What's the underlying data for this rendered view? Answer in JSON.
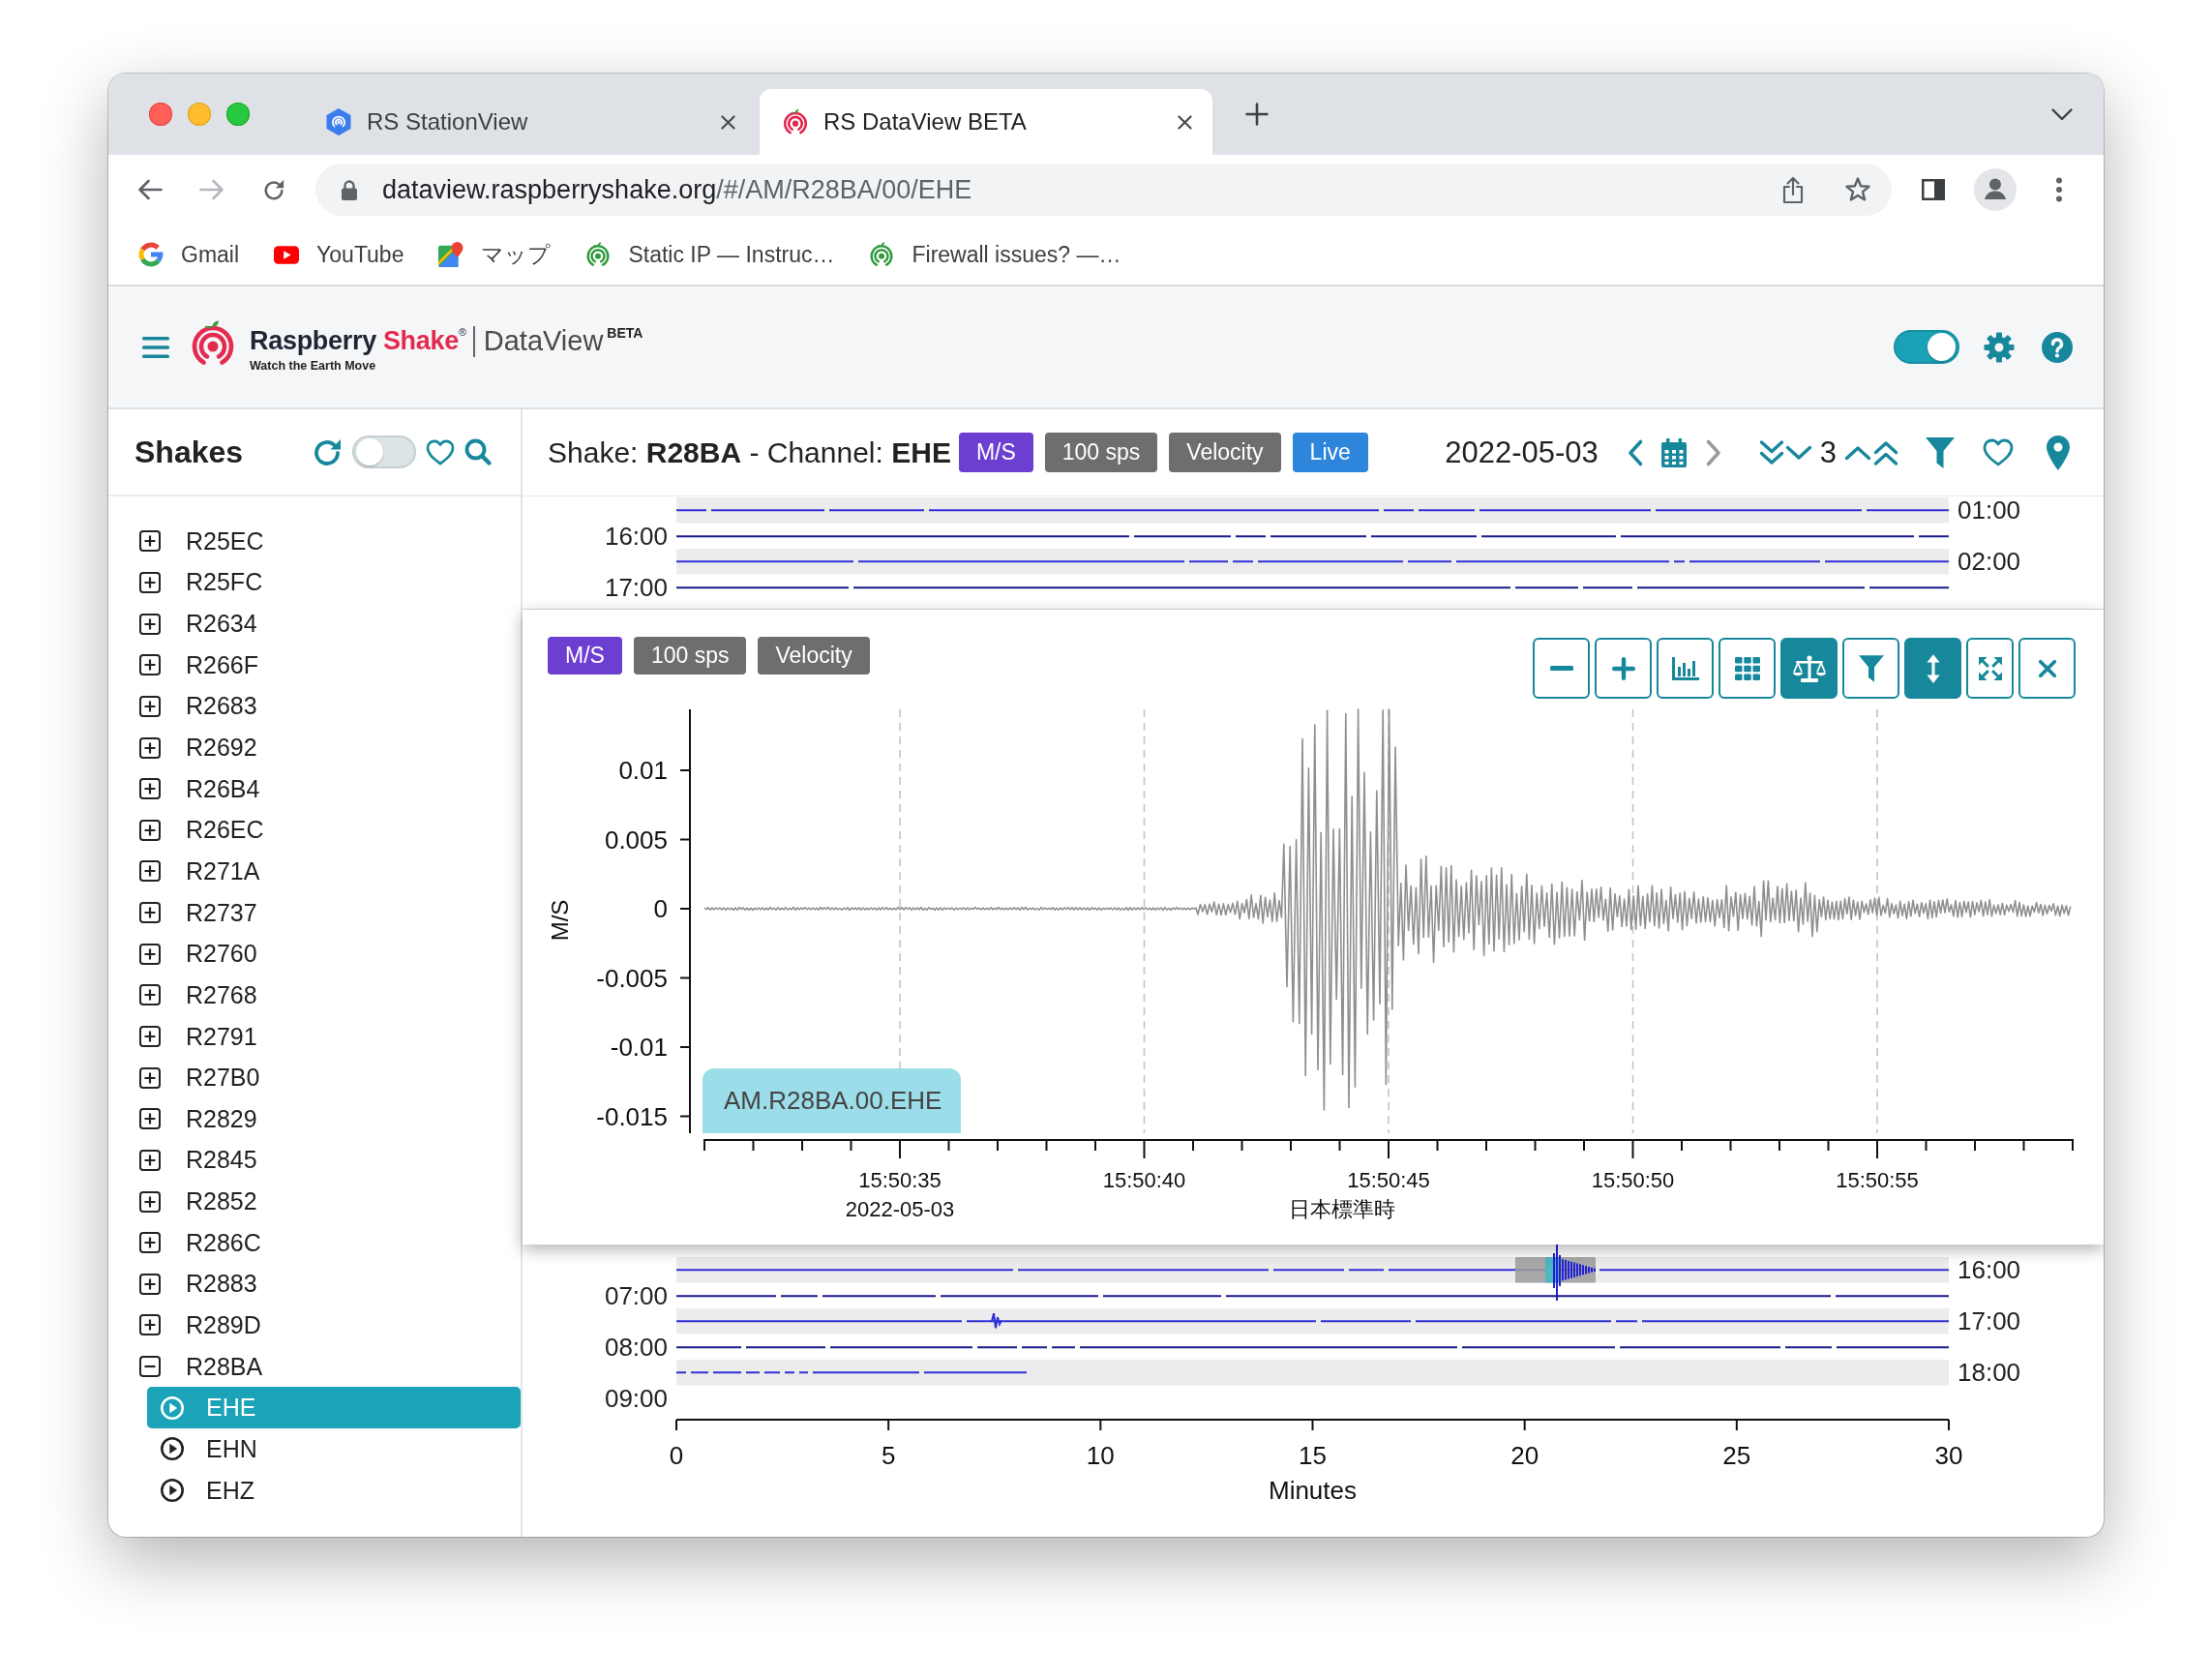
{
  "browser": {
    "tabs": [
      {
        "title": "RS StationView",
        "kind": "station",
        "selected": false
      },
      {
        "title": "RS DataView BETA",
        "kind": "dataview",
        "selected": true
      }
    ],
    "nav": {
      "back_disabled": false,
      "forward_disabled": true
    },
    "address": {
      "host": "dataview.raspberryshake.org",
      "path": "/#/AM/R28BA/00/EHE"
    },
    "bookmarks": [
      {
        "label": "Gmail",
        "kind": "google"
      },
      {
        "label": "YouTube",
        "kind": "video"
      },
      {
        "label": "マップ",
        "kind": "maps"
      },
      {
        "label": "Static IP — Instruc…",
        "kind": "shake"
      },
      {
        "label": "Firewall issues? —…",
        "kind": "shake"
      }
    ]
  },
  "app_header": {
    "brand": "Raspberry",
    "brand_accent": "Shake$^{®}$",
    "product": "DataView$^{BETA}$",
    "tagline": "Watch the Earth Move",
    "toggle": {
      "on": true
    }
  },
  "sidebar": {
    "title": "Shakes",
    "toggle": {
      "on": false
    },
    "stations": [
      {
        "label": "R25EC",
        "expanded": false
      },
      {
        "label": "R25FC",
        "expanded": false
      },
      {
        "label": "R2634",
        "expanded": false
      },
      {
        "label": "R266F",
        "expanded": false
      },
      {
        "label": "R2683",
        "expanded": false
      },
      {
        "label": "R2692",
        "expanded": false
      },
      {
        "label": "R26B4",
        "expanded": false
      },
      {
        "label": "R26EC",
        "expanded": false
      },
      {
        "label": "R271A",
        "expanded": false
      },
      {
        "label": "R2737",
        "expanded": false
      },
      {
        "label": "R2760",
        "expanded": false
      },
      {
        "label": "R2768",
        "expanded": false
      },
      {
        "label": "R2791",
        "expanded": false
      },
      {
        "label": "R27B0",
        "expanded": false
      },
      {
        "label": "R2829",
        "expanded": false
      },
      {
        "label": "R2845",
        "expanded": false
      },
      {
        "label": "R2852",
        "expanded": false
      },
      {
        "label": "R286C",
        "expanded": false
      },
      {
        "label": "R2883",
        "expanded": false
      },
      {
        "label": "R289D",
        "expanded": false
      },
      {
        "label": "R28BA",
        "expanded": true,
        "children": [
          {
            "label": "EHE",
            "selected": true
          },
          {
            "label": "EHN",
            "selected": false
          },
          {
            "label": "EHZ",
            "selected": false
          }
        ]
      }
    ]
  },
  "viewer": {
    "title": "Shake: **R28BA** - Channel: **EHE**",
    "badges": [
      {
        "label": "M/S",
        "color": "#6c3fd1"
      },
      {
        "label": "100 sps",
        "color": "#6e6e6e"
      },
      {
        "label": "Velocity",
        "color": "#6e6e6e"
      },
      {
        "label": "Live",
        "color": "#2d86db"
      }
    ],
    "date": "2022-05-03",
    "prev_disabled": false,
    "next_disabled": true,
    "hours": "3"
  },
  "helicorder": {
    "top_rows": [
      {
        "shaded": true,
        "right_label": "01:00",
        "kind": "trace"
      },
      {
        "shaded": false,
        "left_label": "16:00",
        "kind": "trace"
      },
      {
        "shaded": true,
        "right_label": "02:00",
        "kind": "trace"
      },
      {
        "shaded": false,
        "left_label": "17:00",
        "kind": "trace"
      }
    ],
    "bottom_rows": [
      {
        "shaded": true,
        "right_label": "16:00",
        "kind": "event"
      },
      {
        "shaded": false,
        "left_label": "07:00",
        "kind": "trace"
      },
      {
        "shaded": true,
        "right_label": "17:00",
        "kind": "blip"
      },
      {
        "shaded": false,
        "left_label": "08:00",
        "kind": "trace"
      },
      {
        "shaded": true,
        "right_label": "18:00",
        "kind": "partial"
      },
      {
        "shaded": false,
        "left_label": "09:00",
        "kind": "empty"
      }
    ],
    "x_ticks": [
      "0",
      "5",
      "10",
      "15",
      "20",
      "25",
      "30"
    ],
    "xlabel": "Minutes"
  },
  "trace_panel": {
    "badges": [
      {
        "label": "M/S",
        "color": "#6c3fd1"
      },
      {
        "label": "100 sps",
        "color": "#6e6e6e"
      },
      {
        "label": "Velocity",
        "color": "#6e6e6e"
      }
    ],
    "buttons": [
      {
        "kind": "zoom_out",
        "on": false
      },
      {
        "kind": "zoom_in",
        "on": false
      },
      {
        "kind": "spectrum",
        "on": false
      },
      {
        "kind": "grid",
        "on": false
      },
      {
        "kind": "balance",
        "on": true
      },
      {
        "kind": "filter",
        "on": false
      },
      {
        "kind": "stretch",
        "on": true
      },
      {
        "kind": "fullscreen",
        "on": false
      },
      {
        "kind": "close",
        "on": false
      }
    ],
    "chart": {
      "ylabel": "M/S",
      "y_ticks": [
        "0.01",
        "0.005",
        "0",
        "-0.005",
        "-0.01",
        "-0.015"
      ],
      "x_ticks": [
        "15:50:35",
        "15:50:40",
        "15:50:45",
        "15:50:50",
        "15:50:55"
      ],
      "date": "2022-05-03",
      "timezone": "日本標準時",
      "trace_label": "AM.R28BA.00.EHE"
    }
  }
}
